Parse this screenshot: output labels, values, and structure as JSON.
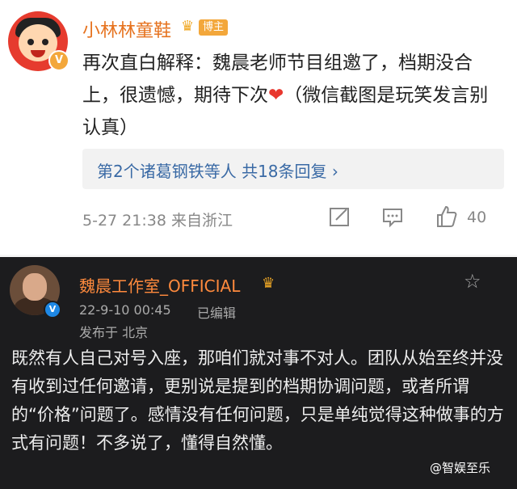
{
  "post1": {
    "username": "小林林童鞋",
    "badge": "博主",
    "text": "再次直白解释：魏晨老师节目组邀了，档期没合上，很遗憾，期待下次",
    "heart": "❤",
    "text_tail": "（微信截图是玩笑发言别认真）",
    "replies": "第2个诸葛钢铁等人 共18条回复 ›",
    "meta": "5-27 21:38  来自浙江",
    "likes": "40",
    "icons": [
      "share-icon",
      "comment-icon",
      "like-icon"
    ]
  },
  "post2": {
    "username": "魏晨工作室_OFFICIAL",
    "datetime": "22-9-10 00:45",
    "edited": "已编辑",
    "location": "发布于 北京",
    "text": "既然有人自己对号入座，那咱们就对事不对人。团队从始至终并没有收到过任何邀请，更别说是提到的档期协调问题，或者所谓的“价格”问题了。感情没有任何问题，只是单纯觉得这种做事的方式有问题！不多说了，懂得自然懂。"
  },
  "watermark": "@智娱至乐",
  "colors": {
    "name_orange": "#e6721e",
    "link_blue": "#3a6aa5",
    "dark_bg": "#1c1c1e"
  }
}
